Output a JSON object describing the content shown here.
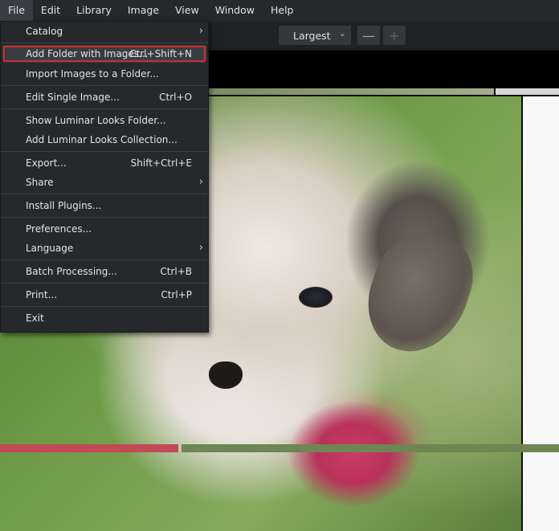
{
  "menubar": {
    "items": [
      "File",
      "Edit",
      "Library",
      "Image",
      "View",
      "Window",
      "Help"
    ],
    "active": "File"
  },
  "toolbar": {
    "size_value": "Largest",
    "size_chevron_icon": "chevron-down-icon",
    "zoom_out": "—",
    "zoom_in": "+"
  },
  "file_menu": {
    "catalog": {
      "label": "Catalog",
      "shortcut": ""
    },
    "add_folder": {
      "label": "Add Folder with Images...",
      "shortcut": "Ctrl+Shift+N"
    },
    "import_images": {
      "label": "Import Images to a Folder...",
      "shortcut": ""
    },
    "edit_single": {
      "label": "Edit Single Image...",
      "shortcut": "Ctrl+O"
    },
    "show_looks": {
      "label": "Show Luminar Looks Folder...",
      "shortcut": ""
    },
    "add_looks": {
      "label": "Add Luminar Looks Collection...",
      "shortcut": ""
    },
    "export": {
      "label": "Export...",
      "shortcut": "Shift+Ctrl+E"
    },
    "share": {
      "label": "Share",
      "shortcut": ""
    },
    "install_plugins": {
      "label": "Install Plugins...",
      "shortcut": ""
    },
    "preferences": {
      "label": "Preferences...",
      "shortcut": ""
    },
    "language": {
      "label": "Language",
      "shortcut": ""
    },
    "batch": {
      "label": "Batch Processing...",
      "shortcut": "Ctrl+B"
    },
    "print": {
      "label": "Print...",
      "shortcut": "Ctrl+P"
    },
    "exit": {
      "label": "Exit",
      "shortcut": ""
    },
    "submenu_arrow": "›",
    "highlight_color": "#c8302a"
  }
}
